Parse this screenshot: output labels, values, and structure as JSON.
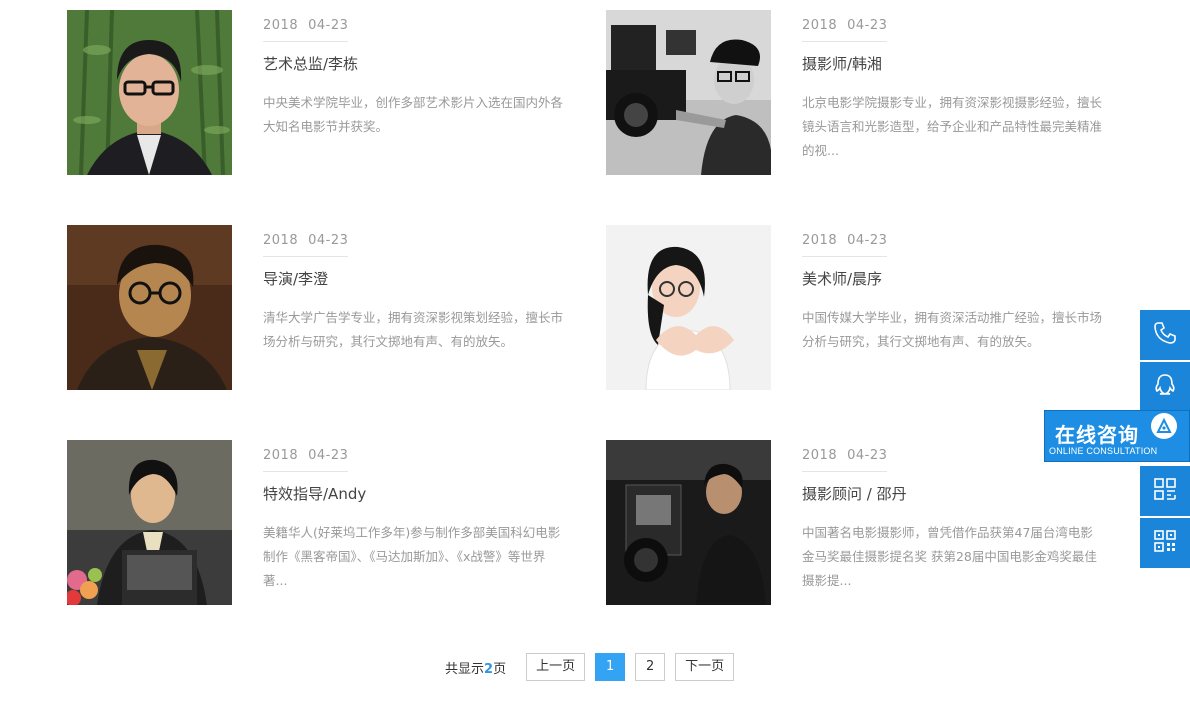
{
  "cards": [
    {
      "year": "2018",
      "date": "04-23",
      "title": "艺术总监/李栋",
      "desc": "中央美术学院毕业，创作多部艺术影片入选在国内外各大知名电影节并获奖。"
    },
    {
      "year": "2018",
      "date": "04-23",
      "title": "摄影师/韩湘",
      "desc": "北京电影学院摄影专业，拥有资深影视摄影经验，擅长镜头语言和光影造型，给予企业和产品特性最完美精准的视..."
    },
    {
      "year": "2018",
      "date": "04-23",
      "title": "导演/李澄",
      "desc": "清华大学广告学专业，拥有资深影视策划经验，擅长市场分析与研究，其行文掷地有声、有的放矢。"
    },
    {
      "year": "2018",
      "date": "04-23",
      "title": "美术师/晨序",
      "desc": "中国传媒大学毕业，拥有资深活动推广经验，擅长市场分析与研究，其行文掷地有声、有的放矢。"
    },
    {
      "year": "2018",
      "date": "04-23",
      "title": "特效指导/Andy",
      "desc": "美籍华人(好莱坞工作多年)参与制作多部美国科幻电影制作《黑客帝国》、《马达加斯加》、《x战警》等世界著..."
    },
    {
      "year": "2018",
      "date": "04-23",
      "title": "摄影顾问 / 邵丹",
      "desc": "中国著名电影摄影师，曾凭借作品获第47届台湾电影金马奖最佳摄影提名奖 获第28届中国电影金鸡奖最佳摄影提..."
    }
  ],
  "pagination": {
    "total_prefix": "共显示",
    "total_pages": "2",
    "total_suffix": "页",
    "prev": "上一页",
    "pages": [
      "1",
      "2"
    ],
    "current": "1",
    "next": "下一页"
  },
  "sidebar": {
    "items": [
      "phone-icon",
      "qq-icon",
      "consult",
      "mobile-qrcode-icon",
      "qrcode-icon"
    ],
    "consult_cn": "在线咨询",
    "consult_en": "ONLINE CONSULTATION",
    "accent": "#1a85d9"
  },
  "colors": {
    "active_page": "#35a3f3",
    "date_text": "#999999",
    "title_text": "#444444"
  }
}
